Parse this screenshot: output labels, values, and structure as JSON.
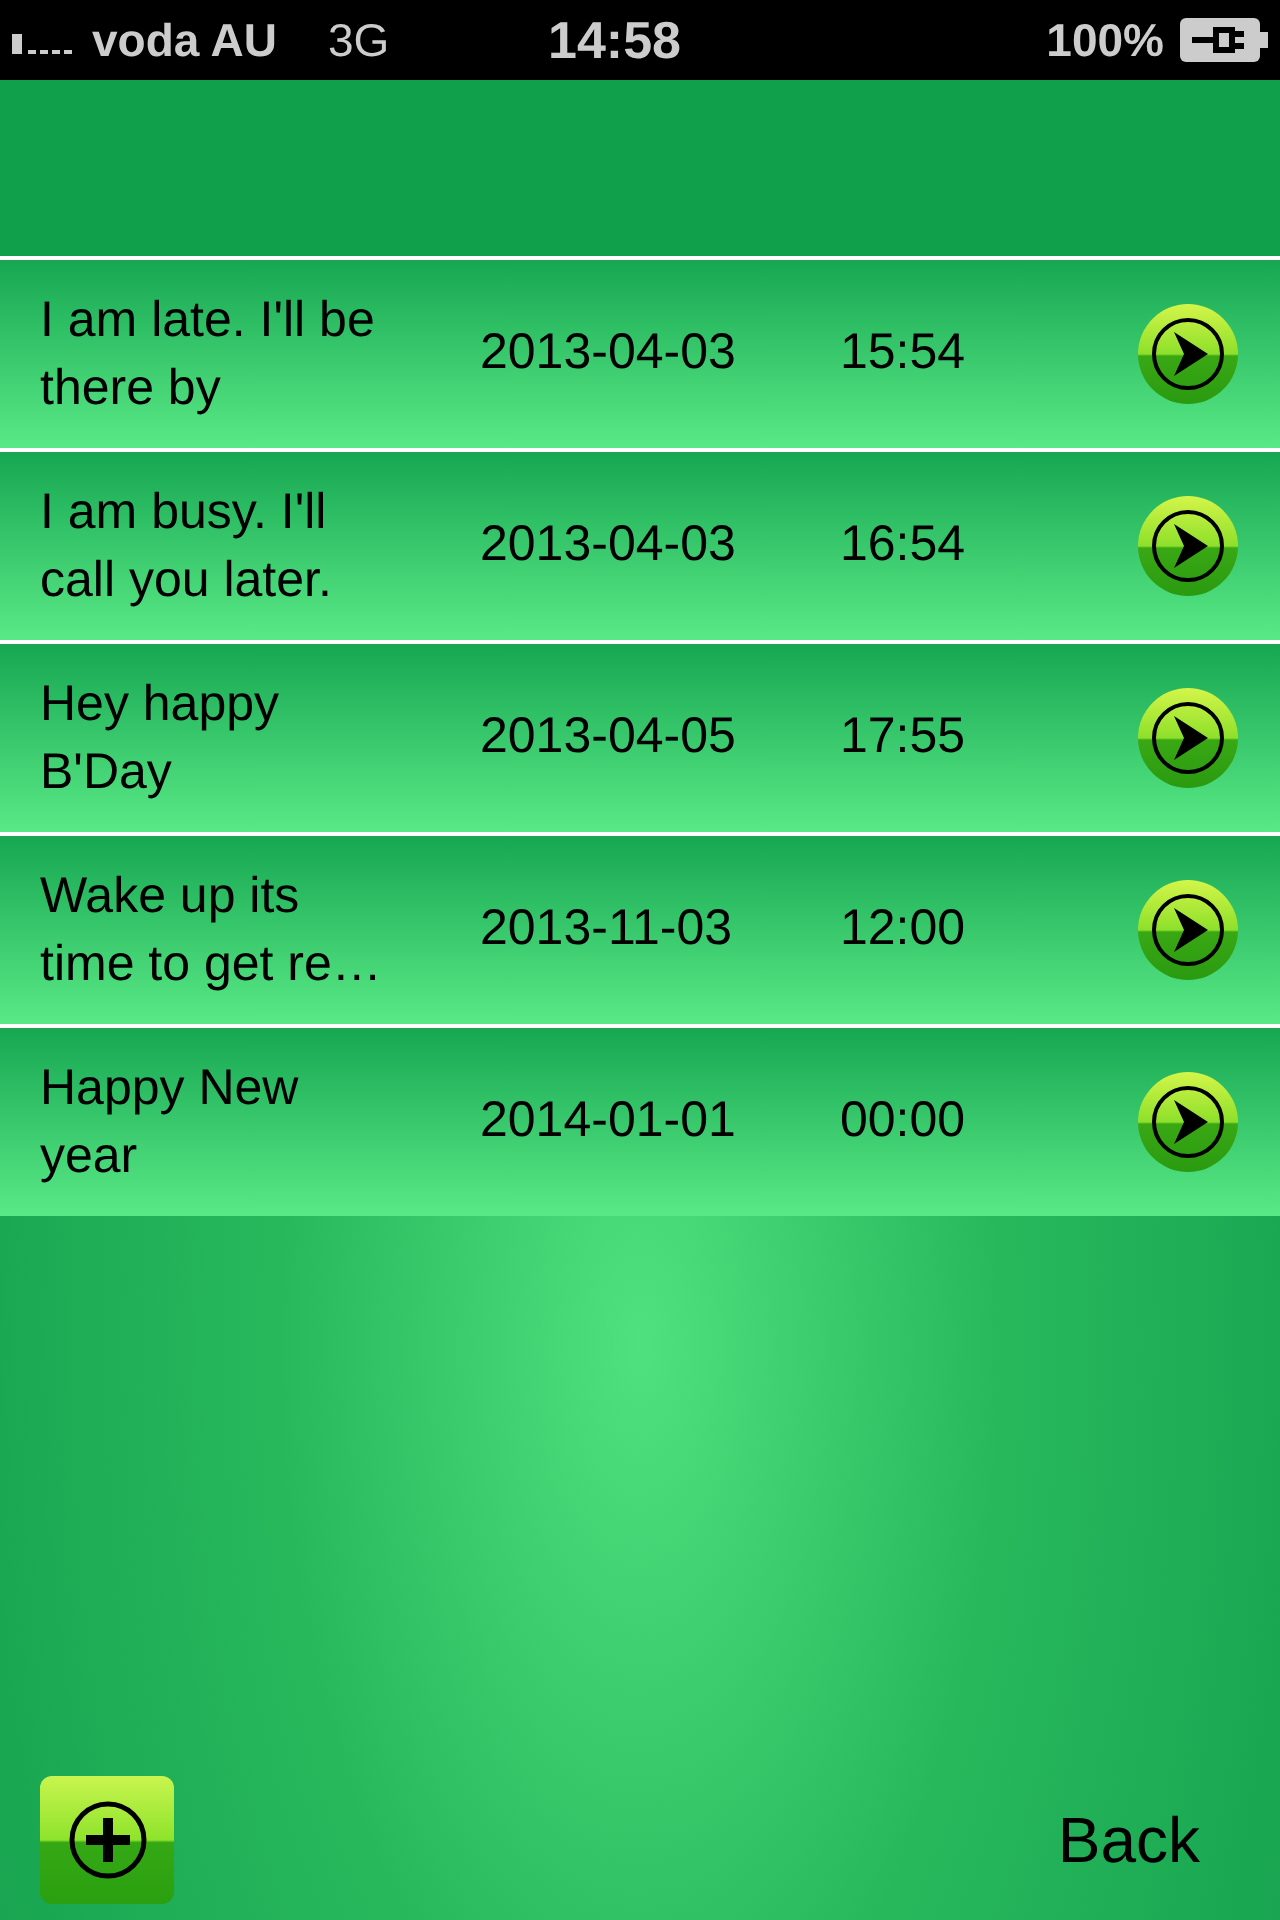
{
  "status_bar": {
    "carrier": "voda AU",
    "network": "3G",
    "time": "14:58",
    "battery": "100%"
  },
  "messages": [
    {
      "text": "I am late. I'll be there by",
      "date": "2013-04-03",
      "time": "15:54"
    },
    {
      "text": "I am busy. I'll call you later.",
      "date": "2013-04-03",
      "time": "16:54"
    },
    {
      "text": "Hey happy B'Day",
      "date": "2013-04-05",
      "time": "17:55"
    },
    {
      "text": "Wake up its time to get re…",
      "date": "2013-11-03",
      "time": "12:00"
    },
    {
      "text": "Happy New year",
      "date": "2014-01-01",
      "time": "00:00"
    }
  ],
  "back_button": "Back"
}
